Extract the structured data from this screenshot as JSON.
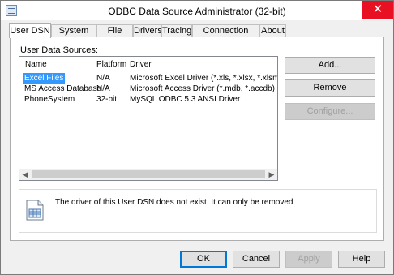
{
  "window": {
    "title": "ODBC Data Source Administrator (32-bit)",
    "close_label": "✕"
  },
  "tabs": [
    {
      "label": "User DSN",
      "active": true
    },
    {
      "label": "System DSN",
      "active": false
    },
    {
      "label": "File DSN",
      "active": false
    },
    {
      "label": "Drivers",
      "active": false
    },
    {
      "label": "Tracing",
      "active": false
    },
    {
      "label": "Connection Pooling",
      "active": false
    },
    {
      "label": "About",
      "active": false
    }
  ],
  "panel": {
    "sources_label": "User Data Sources:",
    "columns": {
      "name": "Name",
      "platform": "Platform",
      "driver": "Driver"
    },
    "rows": [
      {
        "name": "Excel Files",
        "platform": "N/A",
        "driver": "Microsoft Excel Driver (*.xls, *.xlsx, *.xlsm, *.xlsb)",
        "selected": true
      },
      {
        "name": "MS Access Database",
        "platform": "N/A",
        "driver": "Microsoft Access Driver (*.mdb, *.accdb)",
        "selected": false
      },
      {
        "name": "PhoneSystem",
        "platform": "32-bit",
        "driver": "MySQL ODBC 5.3 ANSI Driver",
        "selected": false
      }
    ],
    "buttons": {
      "add": "Add...",
      "remove": "Remove",
      "configure": "Configure..."
    },
    "info_text": "The driver of this User DSN does not exist. It can only be removed"
  },
  "footer": {
    "ok": "OK",
    "cancel": "Cancel",
    "apply": "Apply",
    "help": "Help"
  },
  "colors": {
    "selection": "#3399ff",
    "default_button_border": "#0078d7",
    "close_button": "#e81123"
  },
  "icons": {
    "app": "odbc-app-icon",
    "close": "close-icon",
    "info": "document-icon",
    "scroll_left": "scroll-left-arrow",
    "scroll_right": "scroll-right-arrow"
  }
}
